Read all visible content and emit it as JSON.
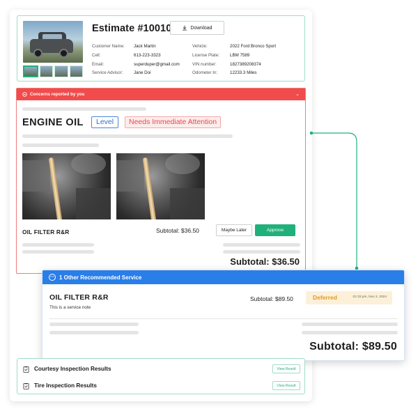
{
  "estimate": {
    "title": "Estimate #10010",
    "download_label": "Download",
    "customer": [
      {
        "label": "Customer Name:",
        "value": "Jack Martin"
      },
      {
        "label": "Cell:",
        "value": "613-223-3323"
      },
      {
        "label": "Email:",
        "value": "superduper@gmail.com"
      },
      {
        "label": "Service Advisor:",
        "value": "Jane Doi"
      }
    ],
    "vehicle": [
      {
        "label": "Vehicle:",
        "value": "2022 Ford Bronco Sport"
      },
      {
        "label": "License Plate:",
        "value": "LBM 7589"
      },
      {
        "label": "VIN number:",
        "value": "1827389208374"
      },
      {
        "label": "Odometer In:",
        "value": "12233.3 Miles"
      }
    ]
  },
  "concerns": {
    "header": "Concerns reported by you",
    "title": "ENGINE OIL",
    "level_tag": "Level",
    "attention_tag": "Needs Immediate Attention",
    "service_name": "OIL FILTER R&R",
    "service_subtotal": "Subtotal:  $36.50",
    "maybe_label": "Maybe Later",
    "approve_label": "Approve",
    "subtotal": "Subtotal:  $36.50"
  },
  "recommended": {
    "header": "1 Other Recommended Service",
    "service_name": "OIL FILTER R&R",
    "note": "This is a service note",
    "subtotal": "Subtotal:  $89.50",
    "status": "Deferred",
    "timestamp": "01:33 pm, Nov 2, 2024",
    "total": "Subtotal:   $89.50"
  },
  "inspections": [
    {
      "label": "Courtesy Inspection Results",
      "button": "View Result"
    },
    {
      "label": "Tire Inspection Results",
      "button": "View Result"
    }
  ],
  "colors": {
    "accent_green": "#20b07a",
    "alert_red": "#f14b4b",
    "primary_blue": "#2a7ee8",
    "deferred_orange": "#e39a22"
  }
}
